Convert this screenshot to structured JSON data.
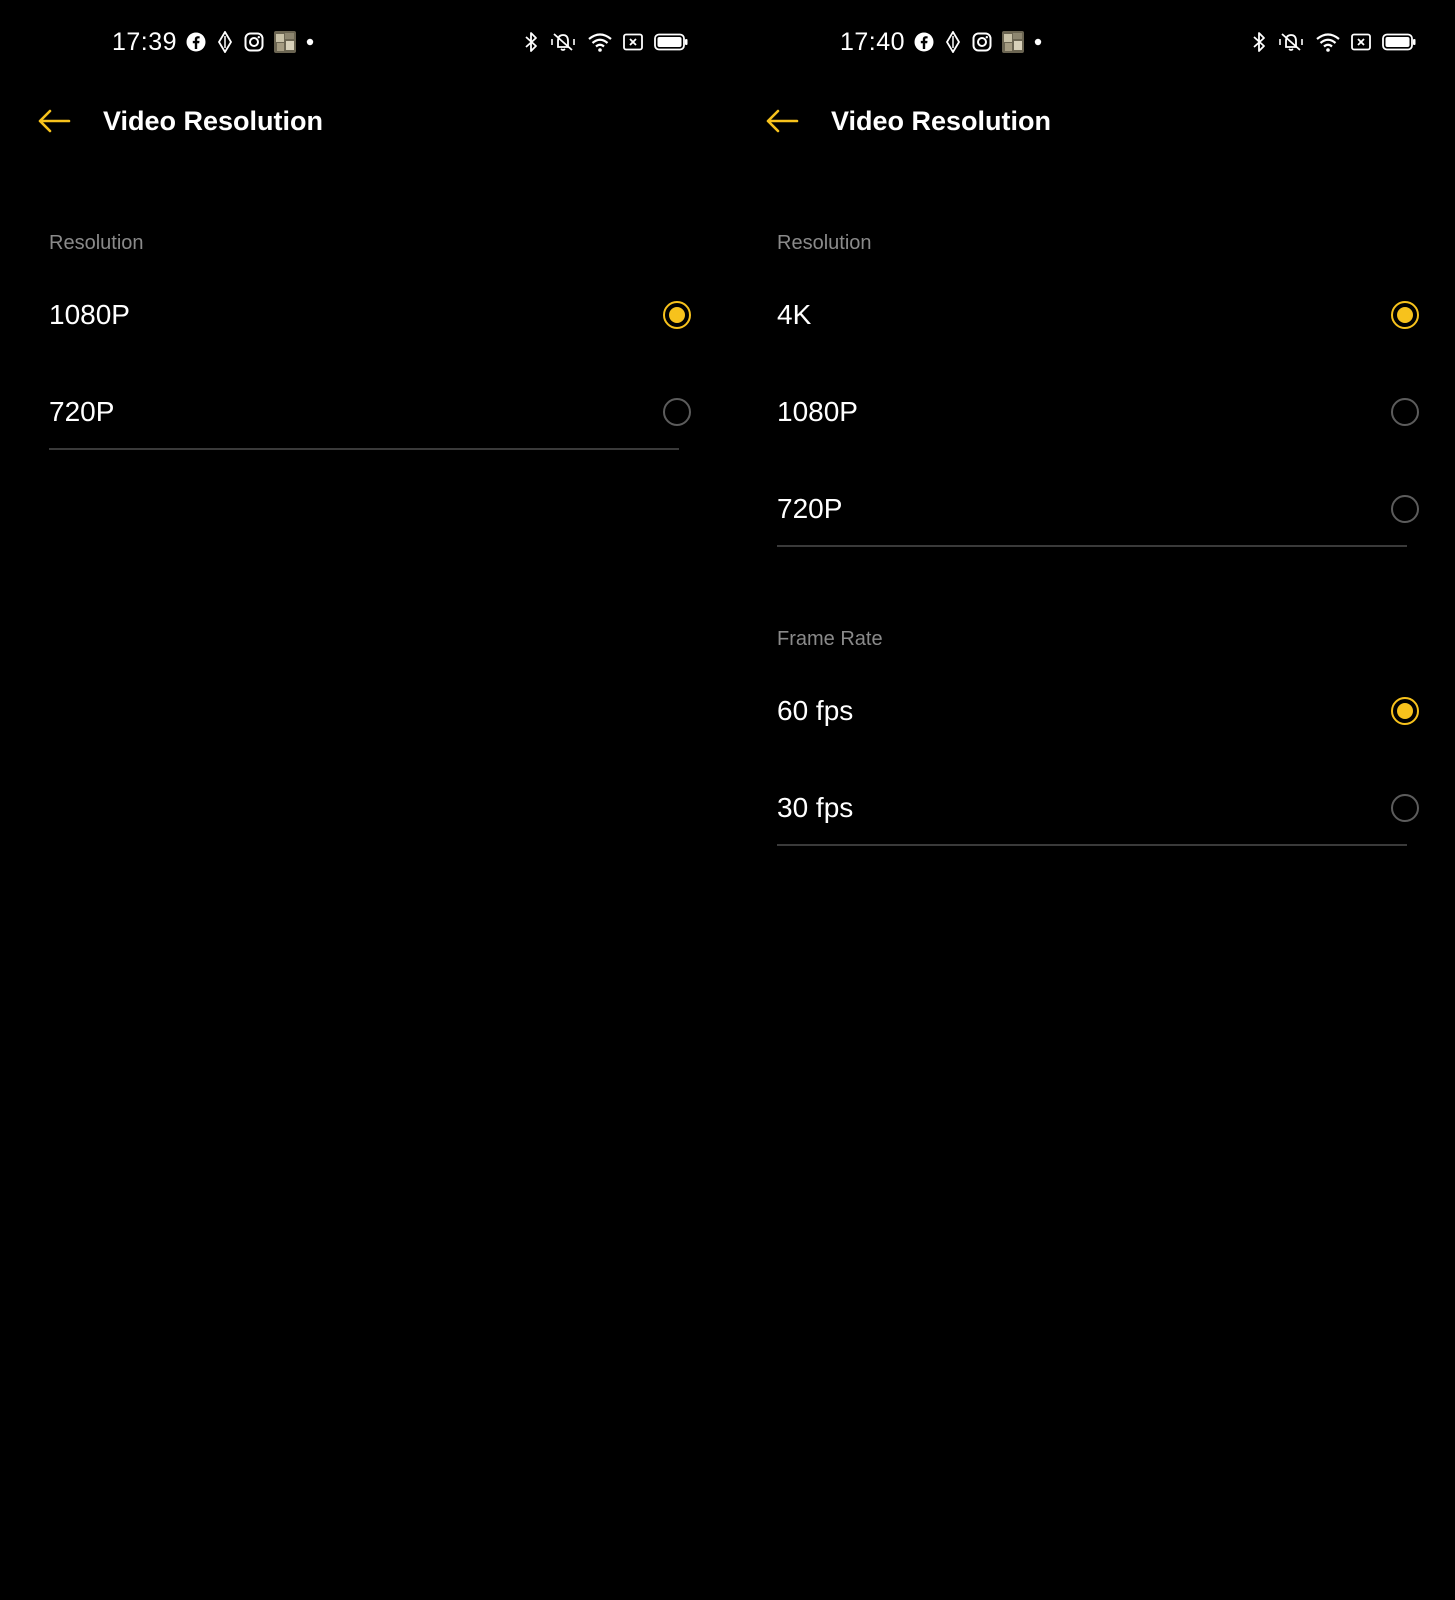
{
  "accent_color": "#f7c21c",
  "screens": [
    {
      "status_bar": {
        "time": "17:39",
        "left_icons": [
          "facebook-icon",
          "navigation-icon",
          "instagram-icon",
          "photo-thumbnail-icon",
          "more-notifications-dot-icon"
        ],
        "right_icons": [
          "bluetooth-icon",
          "vibrate-icon",
          "wifi-icon",
          "no-sim-icon",
          "battery-icon"
        ]
      },
      "header": {
        "back_icon": "arrow-left-icon",
        "title": "Video Resolution"
      },
      "sections": [
        {
          "header": "Resolution",
          "options": [
            {
              "label": "1080P",
              "selected": true
            },
            {
              "label": "720P",
              "selected": false
            }
          ]
        }
      ]
    },
    {
      "status_bar": {
        "time": "17:40",
        "left_icons": [
          "facebook-icon",
          "navigation-icon",
          "instagram-icon",
          "photo-thumbnail-icon",
          "more-notifications-dot-icon"
        ],
        "right_icons": [
          "bluetooth-icon",
          "vibrate-icon",
          "wifi-icon",
          "no-sim-icon",
          "battery-icon"
        ]
      },
      "header": {
        "back_icon": "arrow-left-icon",
        "title": "Video Resolution"
      },
      "sections": [
        {
          "header": "Resolution",
          "options": [
            {
              "label": "4K",
              "selected": true
            },
            {
              "label": "1080P",
              "selected": false
            },
            {
              "label": "720P",
              "selected": false
            }
          ]
        },
        {
          "header": "Frame Rate",
          "options": [
            {
              "label": "60 fps",
              "selected": true
            },
            {
              "label": "30 fps",
              "selected": false
            }
          ]
        }
      ]
    }
  ]
}
